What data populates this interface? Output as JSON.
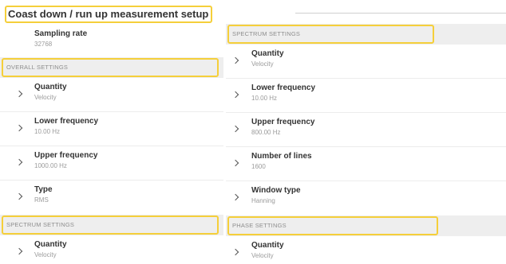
{
  "title": "Coast down / run up measurement setup",
  "left": {
    "sampling": {
      "label": "Sampling rate",
      "value": "32768"
    },
    "overall_header": "OVERALL SETTINGS",
    "overall_items": [
      {
        "label": "Quantity",
        "value": "Velocity"
      },
      {
        "label": "Lower frequency",
        "value": "10.00 Hz"
      },
      {
        "label": "Upper frequency",
        "value": "1000.00 Hz"
      },
      {
        "label": "Type",
        "value": "RMS"
      }
    ],
    "spectrum_header": "SPECTRUM SETTINGS",
    "spectrum_items": [
      {
        "label": "Quantity",
        "value": "Velocity"
      }
    ]
  },
  "right": {
    "spectrum_header": "SPECTRUM SETTINGS",
    "spectrum_items": [
      {
        "label": "Quantity",
        "value": "Velocity"
      },
      {
        "label": "Lower frequency",
        "value": "10.00 Hz"
      },
      {
        "label": "Upper frequency",
        "value": "800.00 Hz"
      },
      {
        "label": "Number of lines",
        "value": "1600"
      },
      {
        "label": "Window type",
        "value": "Hanning"
      }
    ],
    "phase_header": "PHASE SETTINGS",
    "phase_items": [
      {
        "label": "Quantity",
        "value": "Velocity"
      }
    ]
  },
  "colors": {
    "highlight": "#f5cf3a",
    "header_bg": "#eeeeee",
    "muted_text": "#9b9b9b"
  }
}
